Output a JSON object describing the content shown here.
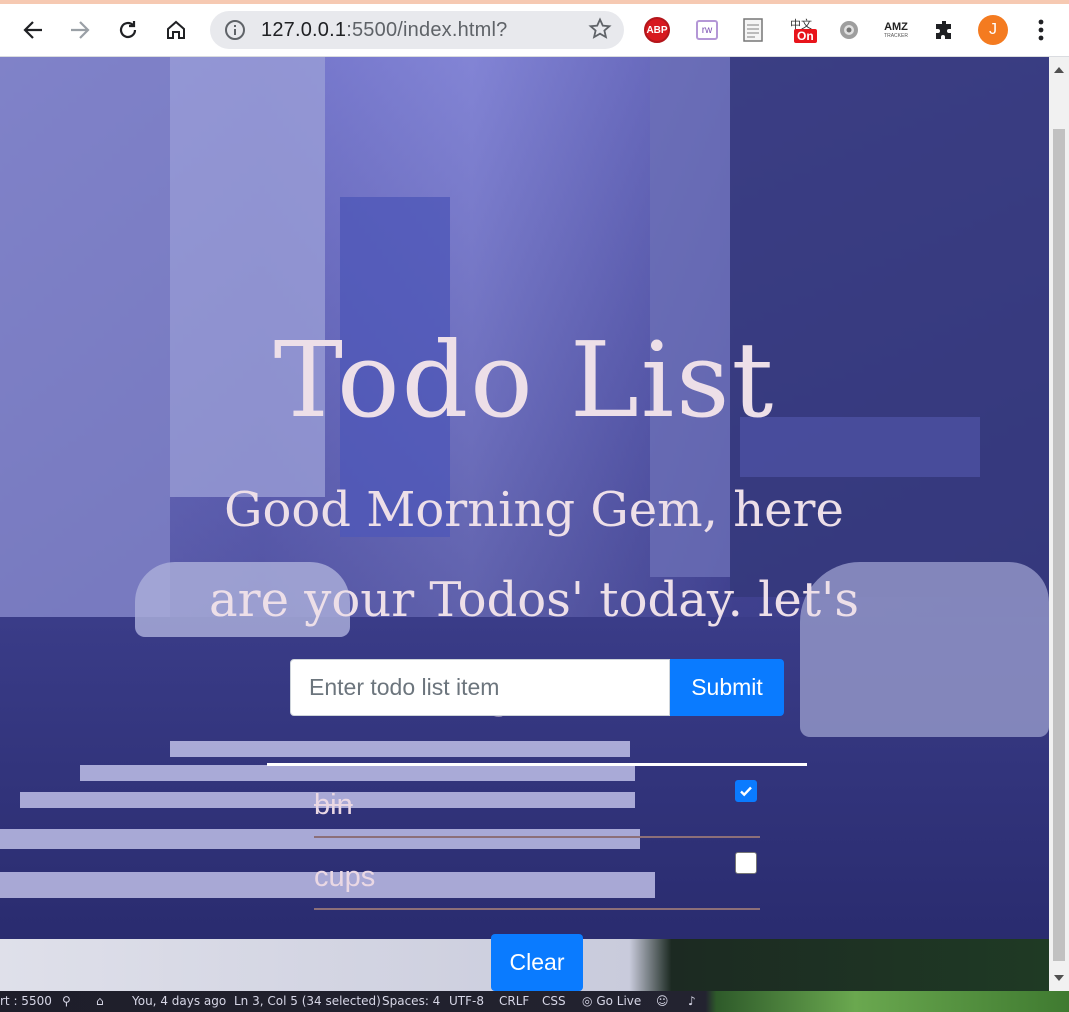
{
  "browser": {
    "url_host": "127.0.0.1",
    "url_rest": ":5500/index.html?",
    "extensions": [
      "adblock-plus-icon",
      "rw-extension-icon",
      "document-icon",
      "on-toggle-extension-icon",
      "gear-extension-icon",
      "amz-tracker-icon",
      "puzzle-icon"
    ],
    "abp_label": "ABP",
    "rw_label": "rw",
    "on_label": "On",
    "amz_label": "AMZ",
    "amz_sub": "TRACKER",
    "avatar_letter": "J"
  },
  "page": {
    "title": "Todo List",
    "greeting": "Good Morning Gem, here are your Todos' today. let's go!!",
    "input_placeholder": "Enter todo list item",
    "submit_label": "Submit",
    "clear_label": "Clear",
    "todos": [
      {
        "text": "bin",
        "done": true
      },
      {
        "text": "cups",
        "done": false
      }
    ]
  },
  "statusbar": {
    "port": "rt : 5500",
    "git": "You, 4 days ago",
    "cursor": "Ln 3, Col 5 (34 selected)",
    "spaces": "Spaces: 4",
    "encoding": "UTF-8",
    "eol": "CRLF",
    "language": "CSS",
    "golive": "Go Live"
  },
  "colors": {
    "accent": "#0a7bff",
    "title_text": "#eddfe8",
    "overlay": "#5a5cb0"
  }
}
